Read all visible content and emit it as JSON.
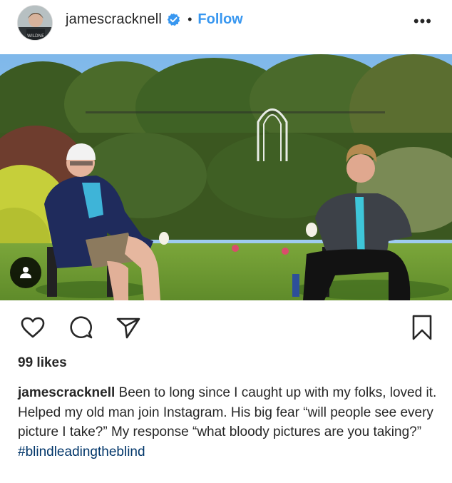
{
  "header": {
    "username": "jamescracknell",
    "separator": "•",
    "follow_label": "Follow",
    "more_label": "•••",
    "verified": true
  },
  "post": {
    "likes_text": "99 likes",
    "caption_user": "jamescracknell",
    "caption_text": "Been to long since I caught up with my folks, loved it. Helped my old man join Instagram. His big fear “will people see every picture I take?” My response “what bloody pictures are you taking?”",
    "hashtag": "#blindleadingtheblind"
  },
  "icons": {
    "verified": "verified-badge-icon",
    "more": "more-options-icon",
    "user_tag": "user-tag-icon",
    "like": "heart-icon",
    "comment": "comment-icon",
    "share": "share-icon",
    "save": "bookmark-icon"
  },
  "colors": {
    "accent": "#3897f0",
    "text": "#262626",
    "hashtag": "#003569",
    "verified": "#3897f0"
  }
}
